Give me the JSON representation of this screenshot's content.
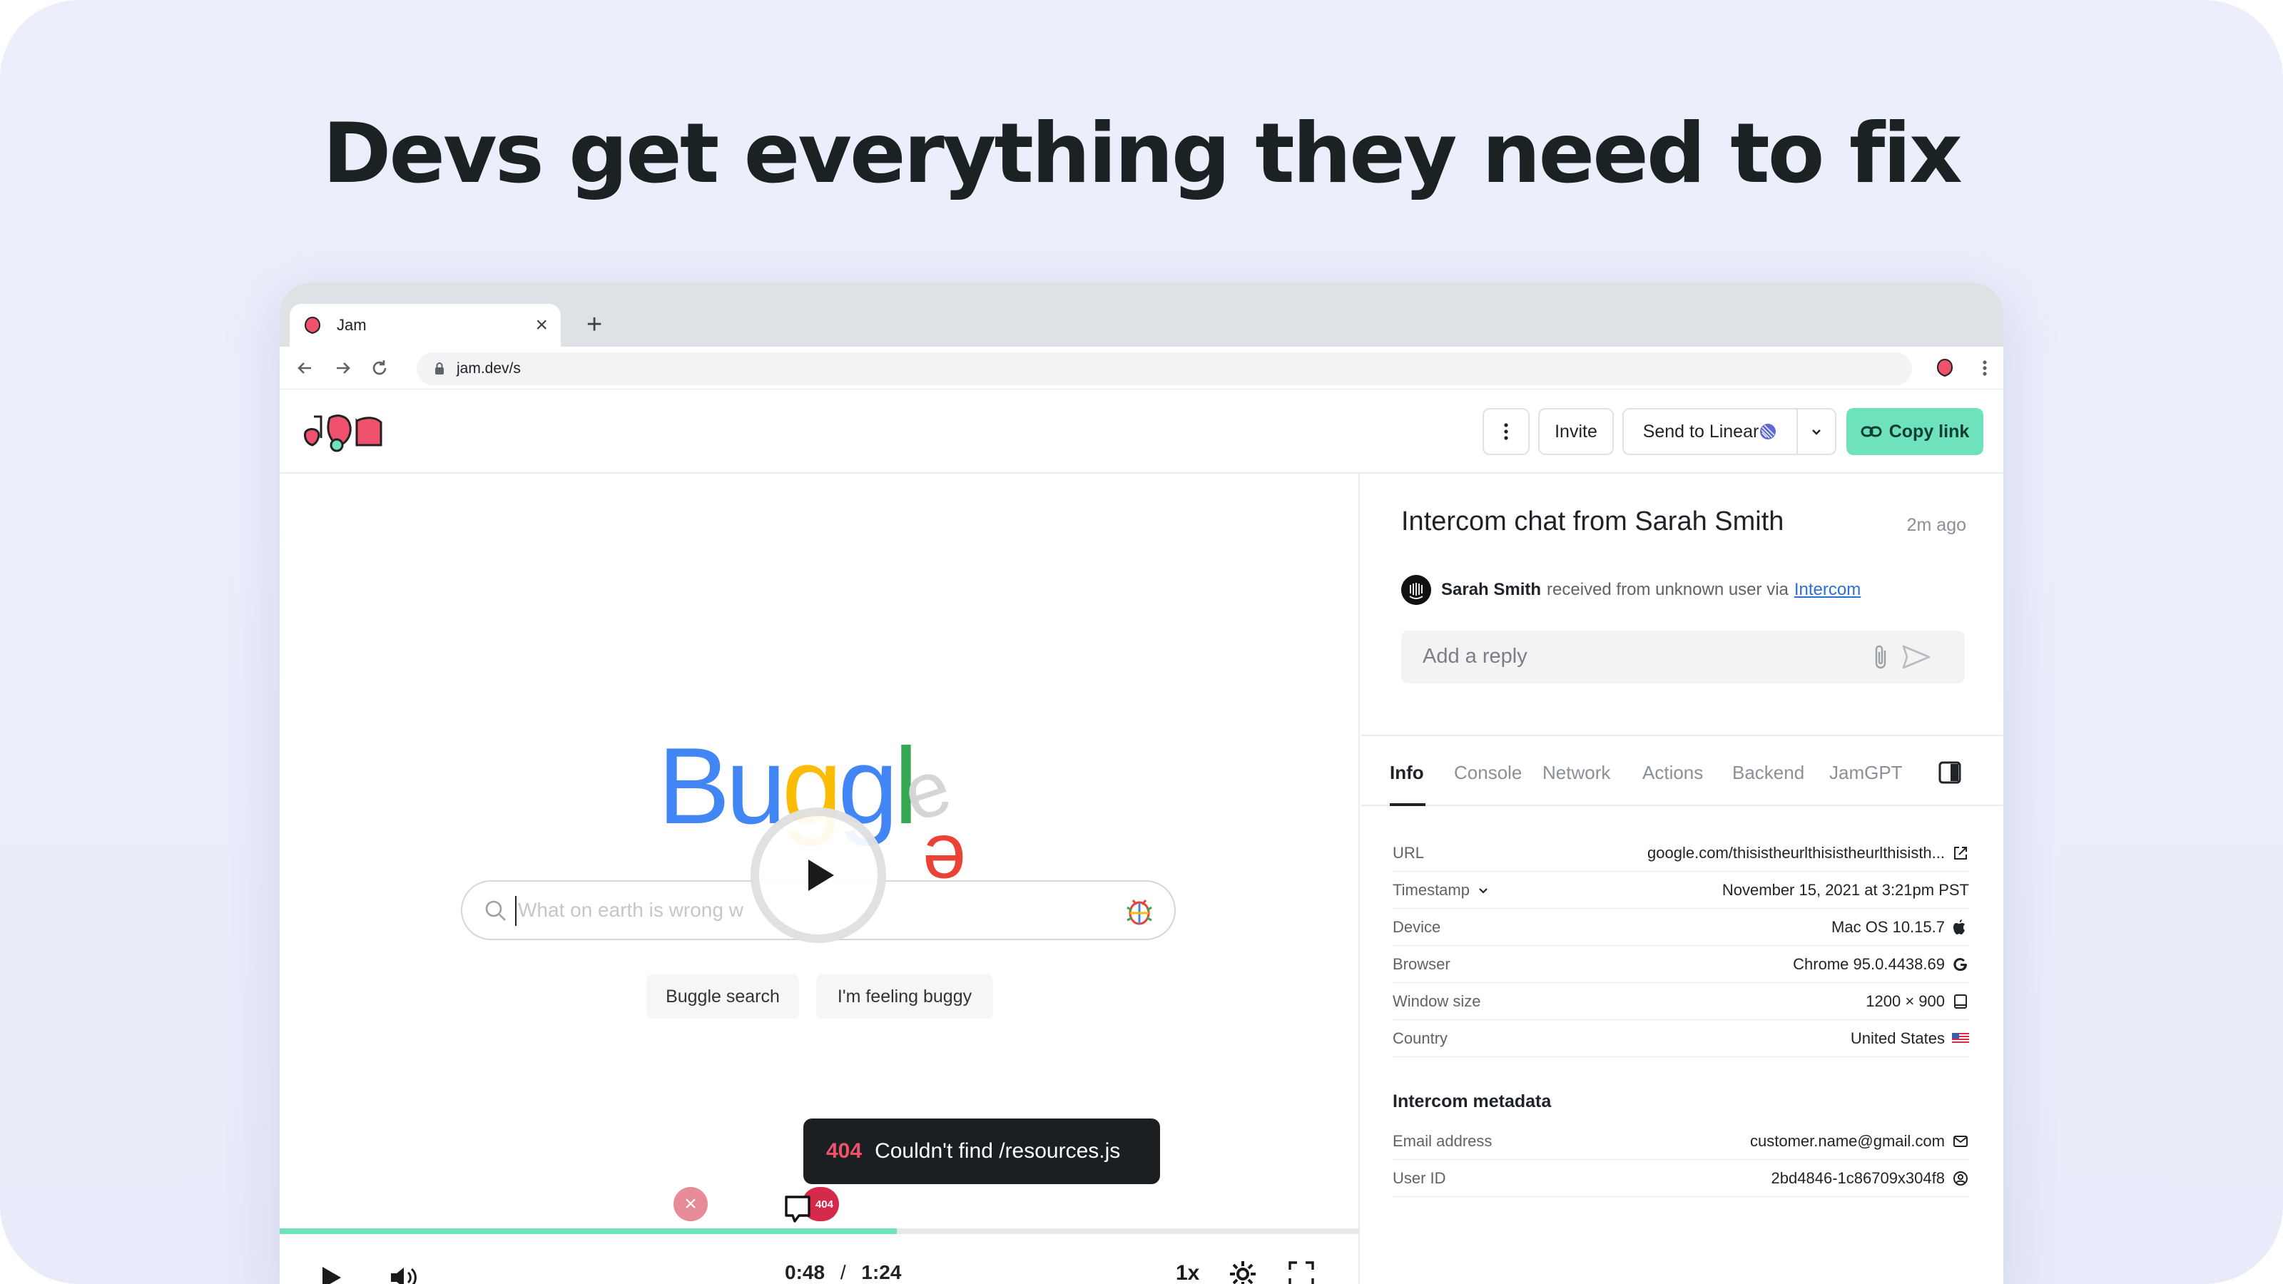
{
  "headline": "Devs get everything they need to fix",
  "browser": {
    "tab_title": "Jam",
    "url": "jam.dev/s"
  },
  "toolbar": {
    "invite_label": "Invite",
    "send_label": "Send to Linear",
    "copy_label": "Copy link"
  },
  "recording": {
    "logo_text": "Buggle",
    "search_placeholder": "What on earth is wrong w",
    "search_button": "Buggle search",
    "lucky_button": "I'm feeling buggy",
    "error_code": "404",
    "error_text": "Couldn't find /resources.js",
    "badge": "404",
    "progress": 0.5714,
    "time_current": "0:48",
    "time_sep": "/",
    "time_total": "1:24",
    "speed": "1x"
  },
  "panel": {
    "title": "Intercom chat from Sarah Smith",
    "time": "2m ago",
    "from_name": "Sarah Smith",
    "from_text": "received from unknown user via",
    "from_link": "Intercom",
    "reply_placeholder": "Add a reply",
    "tabs": [
      {
        "label": "Info"
      },
      {
        "label": "Console"
      },
      {
        "label": "Network"
      },
      {
        "label": "Actions"
      },
      {
        "label": "Backend"
      },
      {
        "label": "JamGPT"
      }
    ],
    "info": [
      {
        "label": "URL",
        "value": "google.com/thisistheurlthisistheurlthisisth..."
      },
      {
        "label": "Timestamp",
        "value": "November 15, 2021 at 3:21pm PST"
      },
      {
        "label": "Device",
        "value": "Mac OS 10.15.7"
      },
      {
        "label": "Browser",
        "value": "Chrome 95.0.4438.69"
      },
      {
        "label": "Window size",
        "value": "1200 × 900"
      },
      {
        "label": "Country",
        "value": "United States"
      }
    ],
    "metadata_title": "Intercom metadata",
    "metadata": [
      {
        "label": "Email address",
        "value": "customer.name@gmail.com"
      },
      {
        "label": "User ID",
        "value": "2bd4846-1c86709x304f8"
      }
    ]
  },
  "colors": {
    "accent": "#6ee2bd",
    "error": "#d62a4b",
    "link": "#2a6fd6"
  }
}
